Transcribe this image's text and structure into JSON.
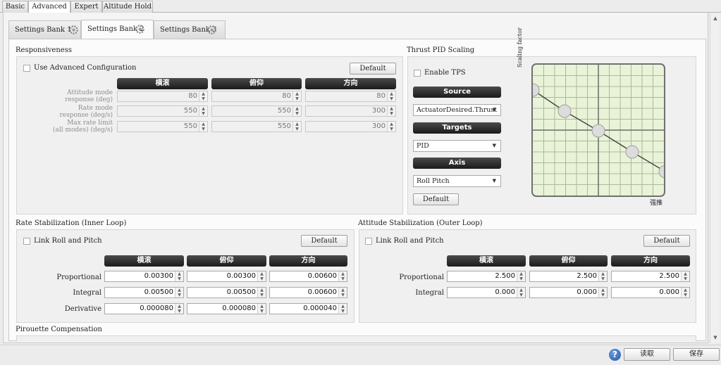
{
  "top_tabs": [
    "Basic",
    "Advanced",
    "Expert",
    "Altitude Hold"
  ],
  "sub_tabs": [
    "Settings Bank 1",
    "Settings Bank 2",
    "Settings Bank 3"
  ],
  "responsiveness": {
    "title": "Responsiveness",
    "use_advanced": "Use Advanced Configuration",
    "default_label": "Default",
    "columns": [
      "横滚",
      "俯仰",
      "方向"
    ],
    "rows": [
      {
        "label1": "Attitude mode",
        "label2": "response (deg)",
        "values": [
          "80",
          "80",
          "80"
        ]
      },
      {
        "label1": "Rate mode",
        "label2": "response (deg/s)",
        "values": [
          "550",
          "550",
          "300"
        ]
      },
      {
        "label1": "Max rate limit",
        "label2": "(all modes) (deg/s)",
        "values": [
          "550",
          "550",
          "300"
        ]
      }
    ]
  },
  "thrust_pid": {
    "title": "Thrust PID Scaling",
    "enable_tps": "Enable TPS",
    "source_header": "Source",
    "source_value": "ActuatorDesired.Thrust",
    "targets_header": "Targets",
    "targets_value": "PID",
    "axis_header": "Axis",
    "axis_value": "Roll Pitch",
    "default_label": "Default",
    "graph_ylabel": "Scaling factor",
    "graph_xlabel": "强推"
  },
  "rate_stab": {
    "title": "Rate Stabilization (Inner Loop)",
    "link_label": "Link Roll and Pitch",
    "default_label": "Default",
    "columns": [
      "横滚",
      "俯仰",
      "方向"
    ],
    "rows": [
      {
        "label": "Proportional",
        "values": [
          "0.00300",
          "0.00300",
          "0.00600"
        ]
      },
      {
        "label": "Integral",
        "values": [
          "0.00500",
          "0.00500",
          "0.00600"
        ]
      },
      {
        "label": "Derivative",
        "values": [
          "0.000080",
          "0.000080",
          "0.000040"
        ]
      }
    ]
  },
  "attitude_stab": {
    "title": "Attitude Stabilization (Outer Loop)",
    "link_label": "Link Roll and Pitch",
    "default_label": "Default",
    "columns": [
      "横滚",
      "俯仰",
      "方向"
    ],
    "rows": [
      {
        "label": "Proportional",
        "values": [
          "2.500",
          "2.500",
          "2.500"
        ]
      },
      {
        "label": "Integral",
        "values": [
          "0.000",
          "0.000",
          "0.000"
        ]
      }
    ]
  },
  "pirouette": {
    "title": "Pirouette Compensation"
  },
  "footer": {
    "help": "?",
    "load_label": "读取",
    "save_label": "保存"
  }
}
